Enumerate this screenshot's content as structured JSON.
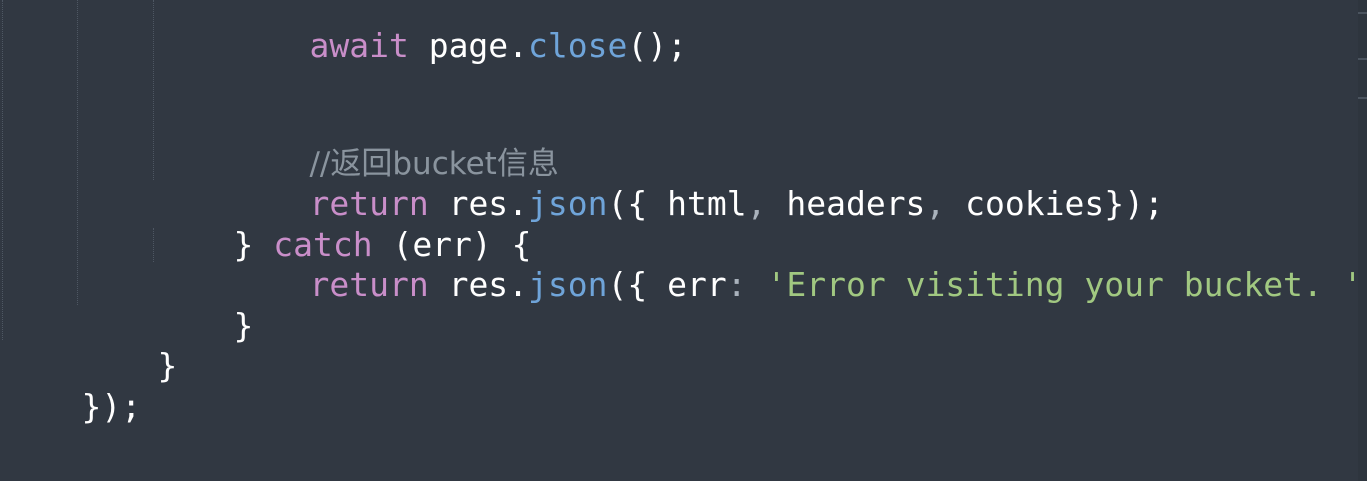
{
  "editor": {
    "lines": [
      {
        "tokens": [
          {
            "text": "await",
            "kind": "kw"
          },
          {
            "text": " page.",
            "kind": "id"
          },
          {
            "text": "close",
            "kind": "fn"
          },
          {
            "text": "();",
            "kind": "pun"
          }
        ]
      },
      {
        "tokens": []
      },
      {
        "tokens": [
          {
            "text": "//返回bucket信息",
            "kind": "cm"
          }
        ]
      },
      {
        "tokens": [
          {
            "text": "return",
            "kind": "kw"
          },
          {
            "text": " res.",
            "kind": "id"
          },
          {
            "text": "json",
            "kind": "fn"
          },
          {
            "text": "({ html",
            "kind": "id"
          },
          {
            "text": ",",
            "kind": "comma"
          },
          {
            "text": " headers",
            "kind": "id"
          },
          {
            "text": ",",
            "kind": "comma"
          },
          {
            "text": " cookies});",
            "kind": "id"
          }
        ]
      },
      {
        "tokens": [
          {
            "text": "} ",
            "kind": "pun"
          },
          {
            "text": "catch",
            "kind": "kw"
          },
          {
            "text": " (err) {",
            "kind": "id"
          }
        ]
      },
      {
        "tokens": [
          {
            "text": "return",
            "kind": "kw"
          },
          {
            "text": " res.",
            "kind": "id"
          },
          {
            "text": "json",
            "kind": "fn"
          },
          {
            "text": "({ err",
            "kind": "id"
          },
          {
            "text": ":",
            "kind": "comma"
          },
          {
            "text": " ",
            "kind": "id"
          },
          {
            "text": "'Error visiting your bucket. '",
            "kind": "str"
          },
          {
            "text": " })",
            "kind": "id"
          }
        ]
      },
      {
        "tokens": [
          {
            "text": "}",
            "kind": "pun"
          }
        ]
      },
      {
        "tokens": [
          {
            "text": "}",
            "kind": "pun"
          }
        ]
      },
      {
        "tokens": [
          {
            "text": "});",
            "kind": "pun"
          }
        ]
      }
    ]
  }
}
